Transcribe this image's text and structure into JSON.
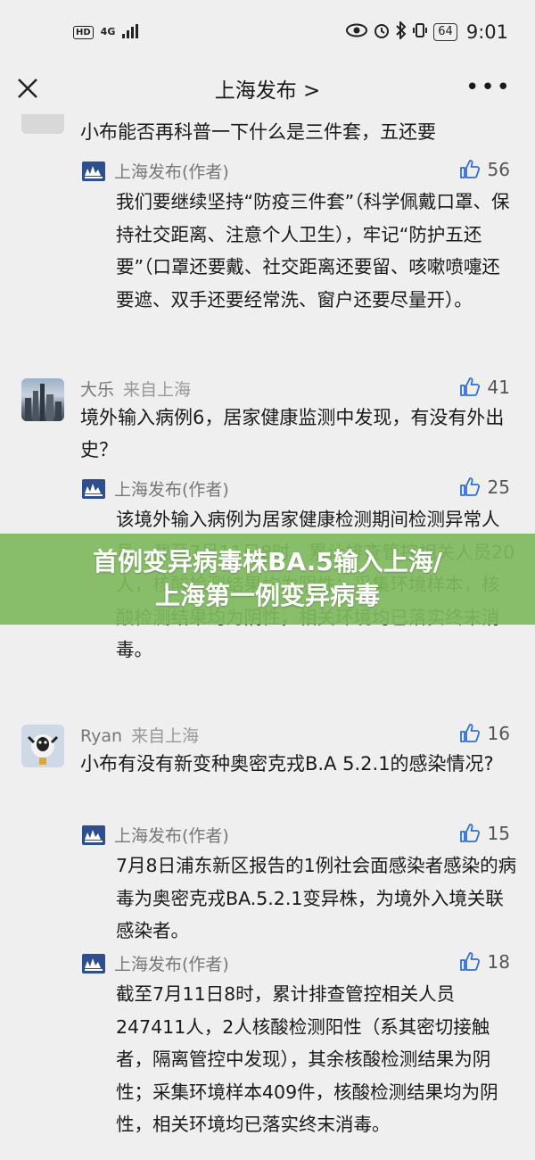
{
  "status_bar": {
    "hd": "HD",
    "network": "4G",
    "battery": "64",
    "time": "9:01"
  },
  "nav": {
    "title": "上海发布 >",
    "more": "•••"
  },
  "comments": [
    {
      "question": "小布能否再科普一下什么是三件套，五还要",
      "replies": [
        {
          "author": "上海发布(作者)",
          "likes": "56",
          "text": "我们要继续坚持“防疫三件套”（科学佩戴口罩、保持社交距离、注意个人卫生），牢记“防护五还要”（口罩还要戴、社交距离还要留、咳嗽喷嚏还要遮、双手还要经常洗、窗户还要尽量开）。"
        }
      ]
    },
    {
      "name": "大乐",
      "from": "来自上海",
      "likes": "41",
      "question": "境外输入病例6，居家健康监测中发现，有没有外出史？",
      "replies": [
        {
          "author": "上海发布(作者)",
          "likes": "25",
          "text": "该境外输入病例为居家健康检测期间检测异常人员。截至7月11日8时，累计排查管控相关人员20人，核酸检测结果均为阴性；采集环境样本，核酸检测结果均为阴性，相关环境均已落实终末消毒。"
        }
      ]
    },
    {
      "name": "Ryan",
      "from": "来自上海",
      "likes": "16",
      "question": "小布有没有新变种奥密克戎B.A 5.2.1的感染情况?",
      "replies": [
        {
          "author": "上海发布(作者)",
          "likes": "15",
          "text": "7月8日浦东新区报告的1例社会面感染者感染的病毒为奥密克戎BA.5.2.1变异株，为境外入境关联感染者。"
        },
        {
          "author": "上海发布(作者)",
          "likes": "18",
          "text": "截至7月11日8时，累计排查管控相关人员247411人，2人核酸检测阳性（系其密切接触者，隔离管控中发现），其余核酸检测结果为阴性；采集环境样本409件，核酸检测结果均为阴性，相关环境均已落实终末消毒。"
        }
      ]
    }
  ],
  "banner": {
    "line1": "首例变异病毒株BA.5输入上海/",
    "line2": "上海第一例变异病毒"
  }
}
